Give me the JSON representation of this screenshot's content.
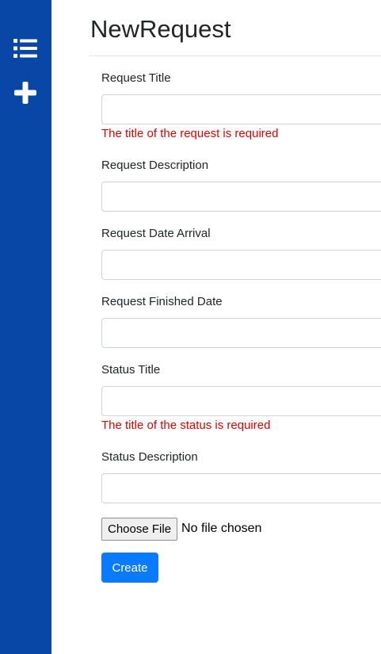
{
  "app": {
    "title": "NewRequest"
  },
  "sidebar": {
    "items": [
      {
        "name": "list",
        "icon": "list-icon"
      },
      {
        "name": "add",
        "icon": "plus-icon"
      }
    ],
    "background": "#0847a6"
  },
  "form": {
    "request_title": {
      "label": "Request Title",
      "value": "",
      "error": "The title of the request is required"
    },
    "request_description": {
      "label": "Request Description",
      "value": ""
    },
    "request_date_arrival": {
      "label": "Request Date Arrival",
      "value": ""
    },
    "request_finished_date": {
      "label": "Request Finished Date",
      "value": ""
    },
    "status_title": {
      "label": "Status Title",
      "value": "",
      "error": "The title of the status is required"
    },
    "status_description": {
      "label": "Status Description",
      "value": ""
    },
    "file": {
      "button_label": "Choose File",
      "status": "No file chosen"
    },
    "submit_label": "Create"
  },
  "colors": {
    "accent": "#0a7bff",
    "error": "#e00000"
  }
}
